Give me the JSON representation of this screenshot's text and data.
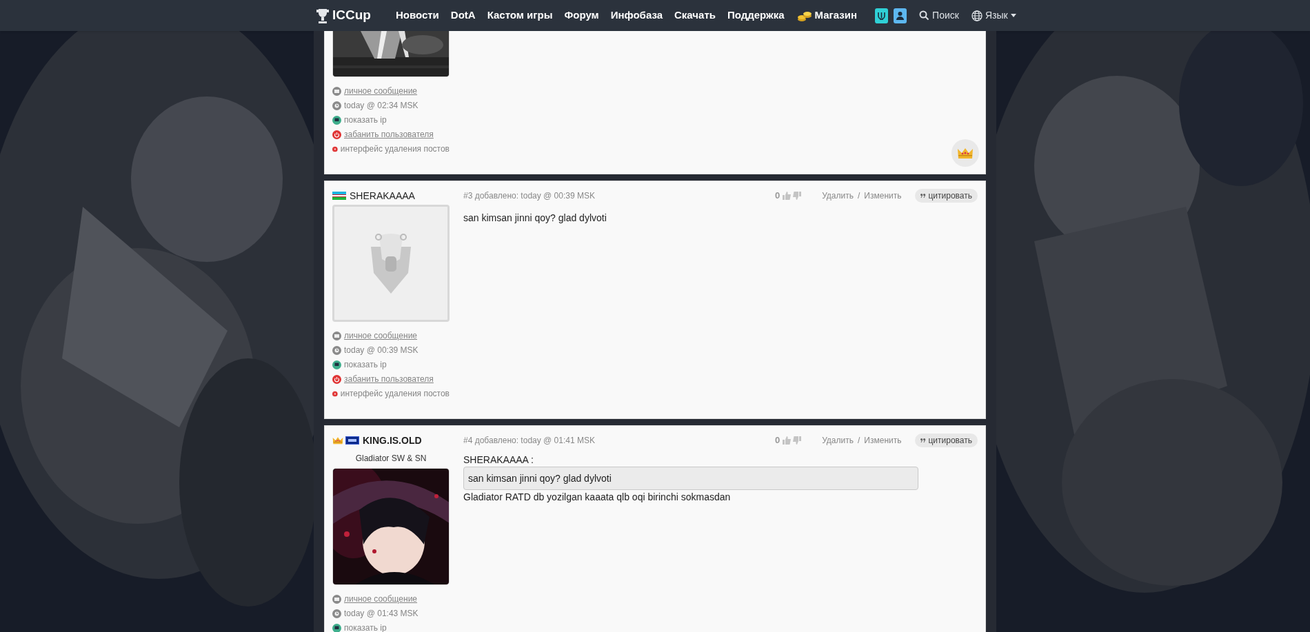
{
  "nav": {
    "logo": "ICCup",
    "items": [
      "Новости",
      "DotA",
      "Кастом игры",
      "Форум",
      "Инфобаза",
      "Скачать",
      "Поддержка"
    ],
    "shop": "Магазин",
    "search": "Поиск",
    "language": "Язык"
  },
  "posts": [
    {
      "avatar": {
        "kind": "picture"
      },
      "links": [
        {
          "kind": "message",
          "text": "личное сообщение"
        },
        {
          "kind": "time",
          "text": "today @ 02:34 MSK"
        },
        {
          "kind": "ip",
          "text": "показать ip"
        },
        {
          "kind": "ban",
          "text": "забанить пользователя"
        },
        {
          "kind": "delete",
          "text": "интерфейс удаления постов"
        }
      ],
      "badge": {
        "kind": "crown"
      }
    },
    {
      "author": {
        "name": "SHERAKAAAA",
        "crown": false,
        "flag": {
          "kind": "uz"
        }
      },
      "meta": "#3 добавлено: today @ 00:39 MSK",
      "rating": "0",
      "delete": "Удалить",
      "separator": "/",
      "edit": "Изменить",
      "quote_button": "цитировать",
      "avatar": {
        "kind": "default"
      },
      "links": [
        {
          "kind": "message",
          "text": "личное сообщение"
        },
        {
          "kind": "time",
          "text": "today @ 00:39 MSK"
        },
        {
          "kind": "ip",
          "text": "показать ip"
        },
        {
          "kind": "ban",
          "text": "забанить пользователя"
        },
        {
          "kind": "delete",
          "text": "интерфейс удаления постов"
        }
      ],
      "body": [
        {
          "kind": "text",
          "text": "san kimsan jinni qoy? glad dylvoti"
        }
      ]
    },
    {
      "author": {
        "name": "KING.IS.OLD",
        "crown": true,
        "flag": {
          "kind": "other"
        }
      },
      "title": "Gladiator SW & SN",
      "meta": "#4 добавлено: today @ 01:41 MSK",
      "rating": "0",
      "delete": "Удалить",
      "separator": "/",
      "edit": "Изменить",
      "quote_button": "цитировать",
      "avatar": {
        "kind": "picture"
      },
      "links": [
        {
          "kind": "message",
          "text": "личное сообщение"
        },
        {
          "kind": "time",
          "text": "today @ 01:43 MSK"
        },
        {
          "kind": "ip",
          "text": "показать ip"
        }
      ],
      "body": [
        {
          "kind": "quote",
          "author": "SHERAKAAAA :",
          "text": "san kimsan jinni qoy? glad dylvoti"
        },
        {
          "kind": "text",
          "text": "Gladiator RATD db yozilgan kaaata qlb oqi birinchi sokmasdan"
        }
      ]
    }
  ]
}
